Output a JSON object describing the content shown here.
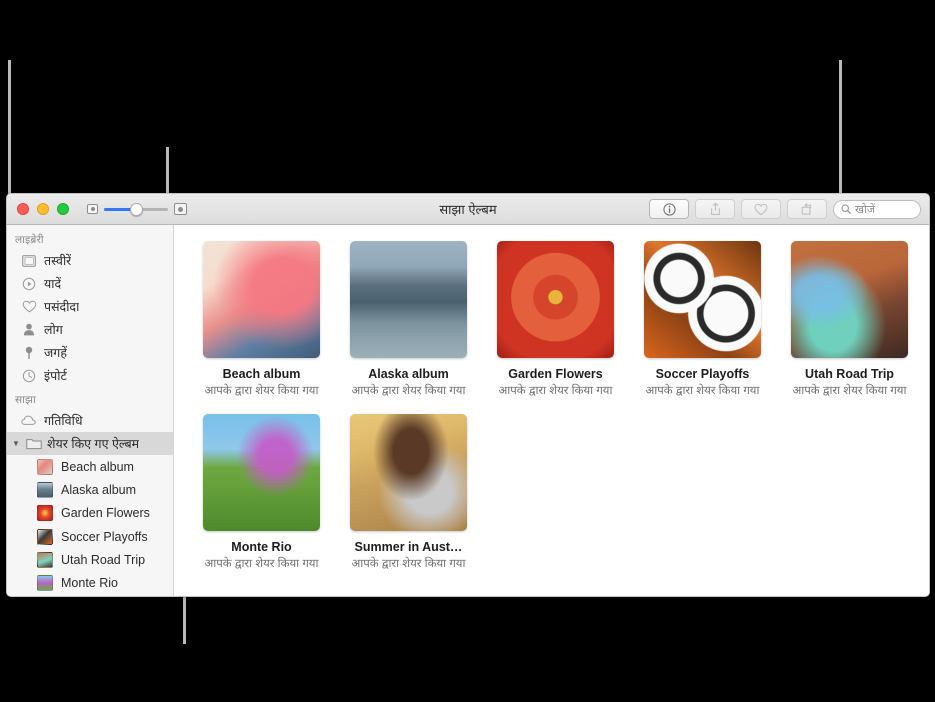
{
  "window": {
    "title": "साझा ऐल्बम",
    "traffic_lights": [
      "close",
      "minimize",
      "zoom"
    ],
    "zoom_slider": {
      "small_icon": "small-photo-icon",
      "large_icon": "large-photo-icon",
      "value": 50
    },
    "toolbar": {
      "info_label": "ⓘ",
      "share_label": "share-icon",
      "favorite_label": "heart-icon",
      "rotate_label": "rotate-icon",
      "search_placeholder": "खोजें"
    }
  },
  "sidebar": {
    "sections": [
      {
        "header": "लाइब्रेरी",
        "items": [
          {
            "label": "तस्वीरें",
            "icon": "photos-icon"
          },
          {
            "label": "यादें",
            "icon": "memories-icon"
          },
          {
            "label": "पसंदीदा",
            "icon": "heart-icon"
          },
          {
            "label": "लोग",
            "icon": "person-icon"
          },
          {
            "label": "जगहें",
            "icon": "pin-icon"
          },
          {
            "label": "इंपोर्ट",
            "icon": "clock-icon"
          }
        ]
      },
      {
        "header": "साझा",
        "items": [
          {
            "label": "गतिविधि",
            "icon": "cloud-icon"
          }
        ]
      }
    ],
    "shared_group": {
      "label": "शेयर किए गए ऐल्बम",
      "icon": "folder-icon",
      "expanded": true,
      "selected": true,
      "albums": [
        {
          "label": "Beach album"
        },
        {
          "label": "Alaska album"
        },
        {
          "label": "Garden Flowers"
        },
        {
          "label": "Soccer Playoffs"
        },
        {
          "label": "Utah Road Trip"
        },
        {
          "label": "Monte Rio"
        }
      ]
    }
  },
  "main": {
    "shared_by_you": "आपके द्वारा शेयर किया गया",
    "albums": [
      {
        "title": "Beach album",
        "subtitle": "आपके द्वारा शेयर किया गया"
      },
      {
        "title": "Alaska album",
        "subtitle": "आपके द्वारा शेयर किया गया"
      },
      {
        "title": "Garden Flowers",
        "subtitle": "आपके द्वारा शेयर किया गया"
      },
      {
        "title": "Soccer Playoffs",
        "subtitle": "आपके द्वारा शेयर किया गया"
      },
      {
        "title": "Utah Road Trip",
        "subtitle": "आपके द्वारा शेयर किया गया"
      },
      {
        "title": "Monte Rio",
        "subtitle": "आपके द्वारा शेयर किया गया"
      },
      {
        "title": "Summer in Aust…",
        "subtitle": "आपके द्वारा शेयर किया गया"
      }
    ]
  },
  "colors": {
    "accent": "#3478f6",
    "background": "#000000",
    "callout": "#b9b9b9",
    "sidebar": "#f6f6f6",
    "selection": "#d8d8d8"
  }
}
